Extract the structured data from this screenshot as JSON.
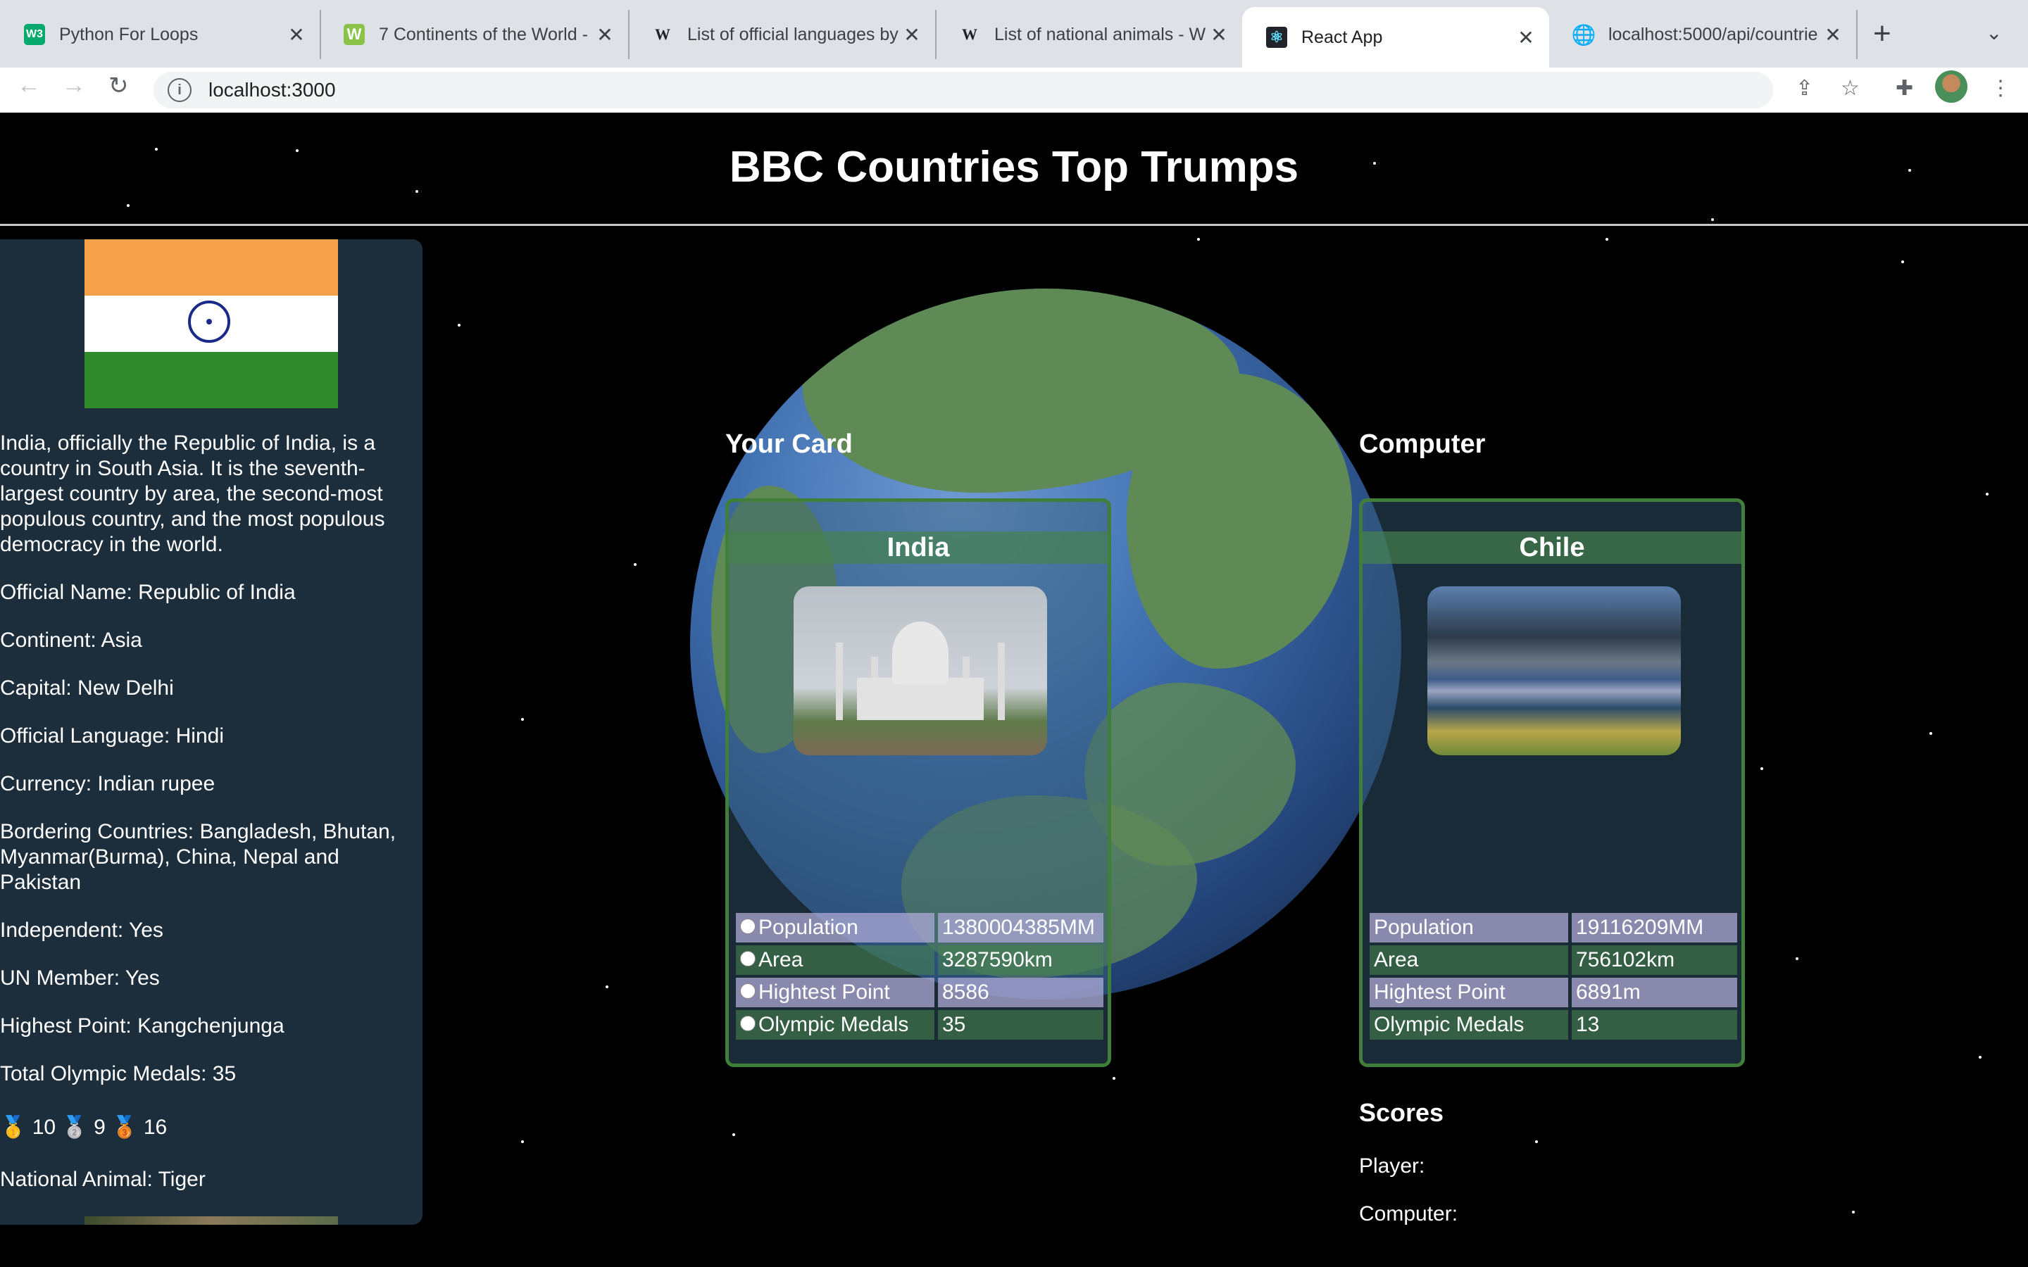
{
  "browser": {
    "tabs": [
      {
        "title": "Python For Loops",
        "favicon": "W3"
      },
      {
        "title": "7 Continents of the World - ",
        "favicon": "W"
      },
      {
        "title": "List of official languages by",
        "favicon": "W"
      },
      {
        "title": "List of national animals - W",
        "favicon": "W"
      },
      {
        "title": "React App",
        "favicon": "react-icon",
        "active": true
      },
      {
        "title": "localhost:5000/api/countrie",
        "favicon": "globe-icon"
      }
    ],
    "new_tab": "+",
    "url": "localhost:3000"
  },
  "page": {
    "title": "BBC Countries Top Trumps"
  },
  "sidebar": {
    "description": "India, officially the Republic of India, is a country in South Asia. It is the seventh-largest country by area, the second-most populous country, and the most populous democracy in the world.",
    "official_name": "Official Name: Republic of India",
    "continent": "Continent: Asia",
    "capital": "Capital: New Delhi",
    "language": "Official Language: Hindi",
    "currency": "Currency: Indian rupee",
    "bordering": "Bordering Countries: Bangladesh, Bhutan, Myanmar(Burma), China, Nepal and Pakistan",
    "independent": "Independent: Yes",
    "un_member": "UN Member: Yes",
    "highest_point": "Highest Point: Kangchenjunga",
    "olympic_total": "Total Olympic Medals: 35",
    "medals": {
      "gold": "🥇",
      "gold_count": "10",
      "silver": "🥈",
      "silver_count": "9",
      "bronze": "🥉",
      "bronze_count": "16"
    },
    "national_animal": "National Animal: Tiger"
  },
  "player": {
    "label": "Your Card",
    "card": {
      "name": "India",
      "stats": [
        {
          "label": "Population",
          "value": "1380004385MM"
        },
        {
          "label": "Area",
          "value": "3287590km"
        },
        {
          "label": "Hightest Point",
          "value": "8586"
        },
        {
          "label": "Olympic Medals",
          "value": "35"
        }
      ]
    }
  },
  "computer": {
    "label": "Computer",
    "card": {
      "name": "Chile",
      "stats": [
        {
          "label": "Population",
          "value": "19116209MM"
        },
        {
          "label": "Area",
          "value": "756102km"
        },
        {
          "label": "Hightest Point",
          "value": "6891m"
        },
        {
          "label": "Olympic Medals",
          "value": "13"
        }
      ]
    }
  },
  "scores": {
    "title": "Scores",
    "player": "Player:",
    "computer": "Computer:"
  }
}
